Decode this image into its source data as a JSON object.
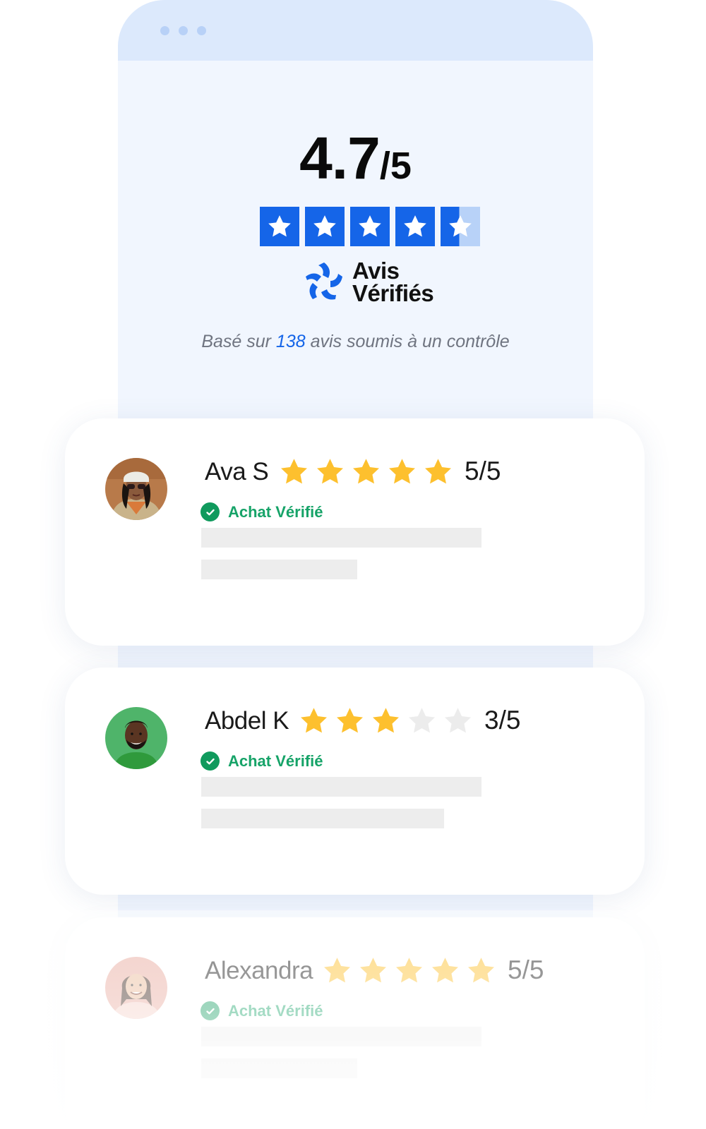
{
  "summary": {
    "rating": "4.7",
    "scale": "/5",
    "brand_line1": "Avis",
    "brand_line2": "Vérifiés",
    "based_pre": "Basé sur ",
    "based_count": "138",
    "based_post": " avis soumis à un contrôle",
    "star_fill": 4.7,
    "star_color": "#1565e8"
  },
  "reviews": [
    {
      "name": "Ava S",
      "rating": 5,
      "score_label": "5/5",
      "verified_label": "Achat Vérifié",
      "avatar": "woman-sunglasses-avatar"
    },
    {
      "name": "Abdel K",
      "rating": 3,
      "score_label": "3/5",
      "verified_label": "Achat Vérifié",
      "avatar": "man-beard-avatar"
    },
    {
      "name": "Alexandra",
      "rating": 5,
      "score_label": "5/5",
      "verified_label": "Achat Vérifié",
      "avatar": "woman-smiling-avatar"
    }
  ],
  "colors": {
    "accent": "#1565e8",
    "star_gold": "#fdc02e",
    "star_empty": "#ececec",
    "verified_green": "#16a368"
  }
}
